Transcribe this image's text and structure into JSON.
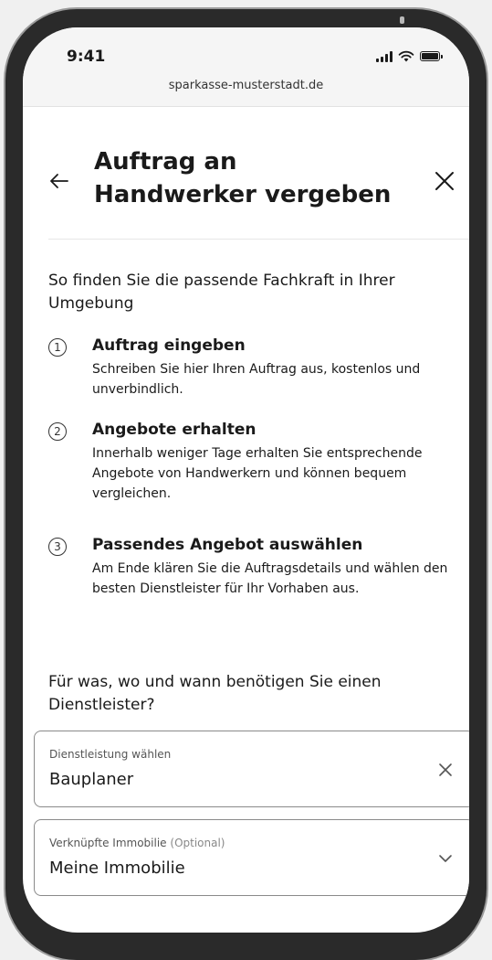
{
  "status_bar": {
    "time": "9:41"
  },
  "browser": {
    "url": "sparkasse-musterstadt.de"
  },
  "header": {
    "title": "Auftrag an Handwerker vergeben"
  },
  "intro": "So finden Sie die passende Fachkraft in Ihrer Umgebung",
  "steps": [
    {
      "number": "1",
      "title": "Auftrag eingeben",
      "description": "Schreiben Sie hier Ihren Auftrag aus, kostenlos und unverbindlich."
    },
    {
      "number": "2",
      "title": "Angebote erhalten",
      "description": "Innerhalb weniger Tage erhalten Sie entsprechende Angebote von Handwerkern und können bequem vergleichen."
    },
    {
      "number": "3",
      "title": "Passendes Angebot auswählen",
      "description": "Am Ende klären Sie die Auftragsdetails und wählen den besten Dienstleister für Ihr Vorhaben aus."
    }
  ],
  "question": "Für was, wo und wann benötigen Sie einen Dienstleister?",
  "fields": {
    "service": {
      "label": "Dienstleistung wählen",
      "value": "Bauplaner"
    },
    "property": {
      "label": "Verknüpfte Immobilie",
      "optional": "(Optional)",
      "value": "Meine Immobilie"
    }
  }
}
